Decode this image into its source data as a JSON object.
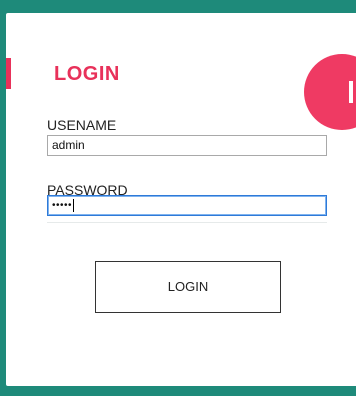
{
  "form": {
    "title": "LOGIN",
    "username_label": "USENAME",
    "username_value": "admin",
    "password_label": "PASSWORD",
    "password_masked": "•••••",
    "button_label": "LOGIN"
  },
  "fab": {
    "icon": "plus-icon"
  },
  "colors": {
    "frame": "#1e8a7a",
    "accent": "#e8315a",
    "fab": "#ef3a63",
    "focus_border": "#2e7ad8"
  }
}
